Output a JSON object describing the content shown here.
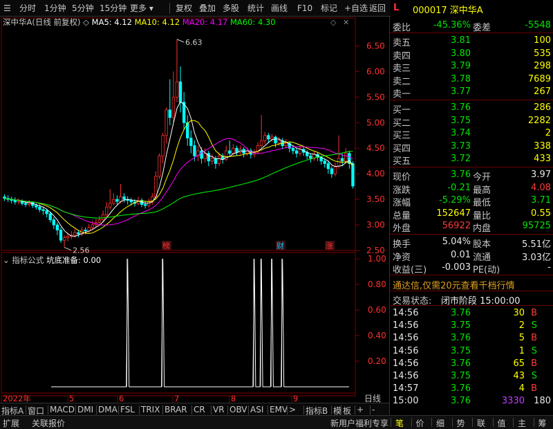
{
  "toolbar": {
    "items": [
      "分时",
      "1分钟",
      "5分钟",
      "15分钟",
      "更多",
      "复权",
      "叠加",
      "多股",
      "统计",
      "画线",
      "F10",
      "标记",
      "+自选",
      "返回"
    ]
  },
  "stock": {
    "flag": "L",
    "code": "000017",
    "name": "深中华A"
  },
  "chart": {
    "title": "深中华A(日线 前复权)",
    "ma5": "MA5: 4.12",
    "ma10": "MA10: 4.12",
    "ma20": "MA20: 4.17",
    "ma60": "MA60: 4.30",
    "high_mark": "6.63",
    "low_mark": "2.56",
    "price_ticks": [
      "6.50",
      "6.00",
      "5.50",
      "5.00",
      "4.50",
      "4.00",
      "3.50",
      "3.00",
      "2.50"
    ],
    "event_labels": [
      "榜",
      "财",
      "涨"
    ],
    "indicator_title": "指标公式",
    "indicator_name": "坑底准备: 0.00",
    "ind_ticks": [
      "1.00",
      "0.80",
      "0.60",
      "0.40",
      "0.20"
    ],
    "x_labels": [
      "2022年",
      "5",
      "6",
      "7",
      "8",
      "9"
    ],
    "x_right": "日线",
    "colors": {
      "ma5": "#ffffff",
      "ma10": "#ffff00",
      "ma20": "#ff00ff",
      "ma60": "#00ff00",
      "up": "#ff3030",
      "down": "#00ffff",
      "grid": "#800000"
    }
  },
  "chart_data": {
    "type": "candlestick",
    "price_range": [
      2.5,
      6.75
    ],
    "candles": [
      [
        3.55,
        3.52,
        3.6,
        3.47
      ],
      [
        3.52,
        3.5,
        3.58,
        3.45
      ],
      [
        3.5,
        3.48,
        3.55,
        3.42
      ],
      [
        3.48,
        3.45,
        3.54,
        3.4
      ],
      [
        3.45,
        3.46,
        3.52,
        3.4
      ],
      [
        3.46,
        3.42,
        3.5,
        3.38
      ],
      [
        3.42,
        3.4,
        3.47,
        3.35
      ],
      [
        3.4,
        3.44,
        3.48,
        3.36
      ],
      [
        3.44,
        3.38,
        3.46,
        3.33
      ],
      [
        3.38,
        3.35,
        3.42,
        3.3
      ],
      [
        3.35,
        3.3,
        3.4,
        3.25
      ],
      [
        3.3,
        3.28,
        3.35,
        3.2
      ],
      [
        3.28,
        3.22,
        3.32,
        3.15
      ],
      [
        3.22,
        3.1,
        3.26,
        3.05
      ],
      [
        3.1,
        3.0,
        3.15,
        2.92
      ],
      [
        3.0,
        2.9,
        3.05,
        2.8
      ],
      [
        2.9,
        2.7,
        2.95,
        2.65
      ],
      [
        2.7,
        2.75,
        2.8,
        2.56
      ],
      [
        2.75,
        2.78,
        2.85,
        2.68
      ],
      [
        2.78,
        2.8,
        2.88,
        2.72
      ],
      [
        2.8,
        2.85,
        2.92,
        2.75
      ],
      [
        2.85,
        2.82,
        2.9,
        2.76
      ],
      [
        2.82,
        2.9,
        2.96,
        2.78
      ],
      [
        2.9,
        2.88,
        2.95,
        2.82
      ],
      [
        2.88,
        2.95,
        3.02,
        2.84
      ],
      [
        2.95,
        3.0,
        3.08,
        2.9
      ],
      [
        3.0,
        3.05,
        3.12,
        2.95
      ],
      [
        3.05,
        3.1,
        3.18,
        3.0
      ],
      [
        3.1,
        3.2,
        3.28,
        3.05
      ],
      [
        3.2,
        3.35,
        3.45,
        3.15
      ],
      [
        3.35,
        3.42,
        3.7,
        3.3
      ],
      [
        3.42,
        3.5,
        3.62,
        3.38
      ],
      [
        3.5,
        3.46,
        3.58,
        3.4
      ],
      [
        3.46,
        3.55,
        3.8,
        3.42
      ],
      [
        3.55,
        3.5,
        3.62,
        3.44
      ],
      [
        3.5,
        3.48,
        3.56,
        3.4
      ],
      [
        3.48,
        3.45,
        3.53,
        3.38
      ],
      [
        3.45,
        3.42,
        3.5,
        3.36
      ],
      [
        3.42,
        3.48,
        3.55,
        3.38
      ],
      [
        3.48,
        3.4,
        3.52,
        3.35
      ],
      [
        3.4,
        3.38,
        3.46,
        3.32
      ],
      [
        3.38,
        3.45,
        3.52,
        3.34
      ],
      [
        3.45,
        3.55,
        3.62,
        3.4
      ],
      [
        3.55,
        3.95,
        4.05,
        3.5
      ],
      [
        3.95,
        4.35,
        4.4,
        3.9
      ],
      [
        4.35,
        4.75,
        4.8,
        4.2
      ],
      [
        4.75,
        5.25,
        5.3,
        4.6
      ],
      [
        5.25,
        5.1,
        5.85,
        4.95
      ],
      [
        5.1,
        5.5,
        6.0,
        5.0
      ],
      [
        5.5,
        5.8,
        6.63,
        5.4
      ],
      [
        5.8,
        5.4,
        6.1,
        5.2
      ],
      [
        5.4,
        5.0,
        5.6,
        4.85
      ],
      [
        5.0,
        4.7,
        5.15,
        4.55
      ],
      [
        4.7,
        4.55,
        4.85,
        4.4
      ],
      [
        4.55,
        4.35,
        4.65,
        4.25
      ],
      [
        4.35,
        4.45,
        4.55,
        4.25
      ],
      [
        4.45,
        4.3,
        4.52,
        4.2
      ],
      [
        4.3,
        4.4,
        4.5,
        4.22
      ],
      [
        4.4,
        4.25,
        4.45,
        4.15
      ],
      [
        4.25,
        4.3,
        4.38,
        4.18
      ],
      [
        4.3,
        4.2,
        4.35,
        4.1
      ],
      [
        4.2,
        4.35,
        4.42,
        4.15
      ],
      [
        4.35,
        4.28,
        4.4,
        4.2
      ],
      [
        4.28,
        4.45,
        4.55,
        4.25
      ],
      [
        4.45,
        4.4,
        4.65,
        4.35
      ],
      [
        4.4,
        4.5,
        4.58,
        4.35
      ],
      [
        4.5,
        4.42,
        4.55,
        4.36
      ],
      [
        4.42,
        4.48,
        4.55,
        4.38
      ],
      [
        4.48,
        4.4,
        4.52,
        4.32
      ],
      [
        4.4,
        4.45,
        4.52,
        4.35
      ],
      [
        4.45,
        4.38,
        4.5,
        4.3
      ],
      [
        4.38,
        4.42,
        4.48,
        4.32
      ],
      [
        4.42,
        4.55,
        4.62,
        4.4
      ],
      [
        4.55,
        4.65,
        5.15,
        4.5
      ],
      [
        4.65,
        4.75,
        4.82,
        4.58
      ],
      [
        4.75,
        4.68,
        4.8,
        4.6
      ],
      [
        4.68,
        4.72,
        4.78,
        4.62
      ],
      [
        4.72,
        4.6,
        4.75,
        4.52
      ],
      [
        4.6,
        4.65,
        4.72,
        4.55
      ],
      [
        4.65,
        4.55,
        4.7,
        4.48
      ],
      [
        4.55,
        4.6,
        4.68,
        4.5
      ],
      [
        4.6,
        4.5,
        4.62,
        4.42
      ],
      [
        4.5,
        4.45,
        4.55,
        4.38
      ],
      [
        4.45,
        4.4,
        4.5,
        4.32
      ],
      [
        4.4,
        4.48,
        4.55,
        4.35
      ],
      [
        4.48,
        4.42,
        4.52,
        4.35
      ],
      [
        4.42,
        4.35,
        4.46,
        4.28
      ],
      [
        4.35,
        4.3,
        4.4,
        4.22
      ],
      [
        4.3,
        4.38,
        4.45,
        4.25
      ],
      [
        4.38,
        4.32,
        4.42,
        4.25
      ],
      [
        4.32,
        4.25,
        4.36,
        4.18
      ],
      [
        4.25,
        4.2,
        4.3,
        4.12
      ],
      [
        4.2,
        4.1,
        4.25,
        4.0
      ],
      [
        4.1,
        4.0,
        4.15,
        3.92
      ],
      [
        4.0,
        4.15,
        4.22,
        3.95
      ],
      [
        4.15,
        4.3,
        4.75,
        4.1
      ],
      [
        4.3,
        4.25,
        4.4,
        4.15
      ],
      [
        4.25,
        4.4,
        4.5,
        4.2
      ],
      [
        4.4,
        4.2,
        4.45,
        4.1
      ],
      [
        4.2,
        3.76,
        4.25,
        3.71
      ]
    ],
    "signal_spikes": [
      35,
      45,
      71,
      73,
      76,
      79
    ]
  },
  "quote": {
    "weibi_label": "委比",
    "weibi_val": "-45.36%",
    "weicha_label": "委差",
    "weicha_val": "-5548",
    "asks": [
      {
        "label": "卖五",
        "price": "3.81",
        "vol": "100"
      },
      {
        "label": "卖四",
        "price": "3.80",
        "vol": "535"
      },
      {
        "label": "卖三",
        "price": "3.79",
        "vol": "298"
      },
      {
        "label": "卖二",
        "price": "3.78",
        "vol": "7689"
      },
      {
        "label": "卖一",
        "price": "3.77",
        "vol": "267"
      }
    ],
    "bids": [
      {
        "label": "买一",
        "price": "3.76",
        "vol": "286"
      },
      {
        "label": "买二",
        "price": "3.75",
        "vol": "2282"
      },
      {
        "label": "买三",
        "price": "3.74",
        "vol": "2"
      },
      {
        "label": "买四",
        "price": "3.73",
        "vol": "338"
      },
      {
        "label": "买五",
        "price": "3.72",
        "vol": "433"
      }
    ],
    "stats": [
      {
        "l1": "现价",
        "v1": "3.76",
        "c1": "green",
        "l2": "今开",
        "v2": "3.97",
        "c2": "white"
      },
      {
        "l1": "涨跌",
        "v1": "-0.21",
        "c1": "green",
        "l2": "最高",
        "v2": "4.08",
        "c2": "red"
      },
      {
        "l1": "涨幅",
        "v1": "-5.29%",
        "c1": "green",
        "l2": "最低",
        "v2": "3.71",
        "c2": "green"
      },
      {
        "l1": "总量",
        "v1": "152647",
        "c1": "yellow",
        "l2": "量比",
        "v2": "0.55",
        "c2": "yellow"
      },
      {
        "l1": "外盘",
        "v1": "56922",
        "c1": "red",
        "l2": "内盘",
        "v2": "95725",
        "c2": "green"
      }
    ],
    "stats2": [
      {
        "l1": "换手",
        "v1": "5.04%",
        "c1": "white",
        "l2": "股本",
        "v2": "5.51亿",
        "c2": "white"
      },
      {
        "l1": "净资",
        "v1": "0.01",
        "c1": "white",
        "l2": "流通",
        "v2": "3.03亿",
        "c2": "white"
      },
      {
        "l1": "收益(三)",
        "v1": "-0.003",
        "c1": "white",
        "l2": "PE(动)",
        "v2": "-",
        "c2": "white"
      }
    ],
    "ad_text": "通达信,仅需20元查看千档行情",
    "trade_state_label": "交易状态:",
    "trade_state": "闭市阶段 15:00:00",
    "ticks": [
      {
        "t": "14:56",
        "p": "3.76",
        "v": "30",
        "s": "B"
      },
      {
        "t": "14:56",
        "p": "3.75",
        "v": "2",
        "s": "S"
      },
      {
        "t": "14:56",
        "p": "3.76",
        "v": "5",
        "s": "B"
      },
      {
        "t": "14:56",
        "p": "3.75",
        "v": "1",
        "s": "S"
      },
      {
        "t": "14:56",
        "p": "3.76",
        "v": "65",
        "s": "B"
      },
      {
        "t": "14:56",
        "p": "3.75",
        "v": "43",
        "s": "S"
      },
      {
        "t": "14:57",
        "p": "3.76",
        "v": "4",
        "s": "B"
      },
      {
        "t": "15:00",
        "p": "3.76",
        "v": "3330",
        "s": "180"
      }
    ]
  },
  "indicator_tabs": [
    "指标A",
    "窗口",
    "MACD",
    "DMI",
    "DMA",
    "FSL",
    "TRIX",
    "BRAR",
    "CR",
    "VR",
    "OBV",
    "ASI",
    "EMV",
    ">",
    "指标B",
    "模",
    "板",
    "+",
    "-"
  ],
  "bottom_bar": {
    "left": [
      "扩展",
      "关联报价"
    ],
    "promo": "新用户福利专享",
    "tabs": [
      "笔",
      "价",
      "细",
      "势",
      "联",
      "值",
      "主",
      "筹"
    ]
  }
}
